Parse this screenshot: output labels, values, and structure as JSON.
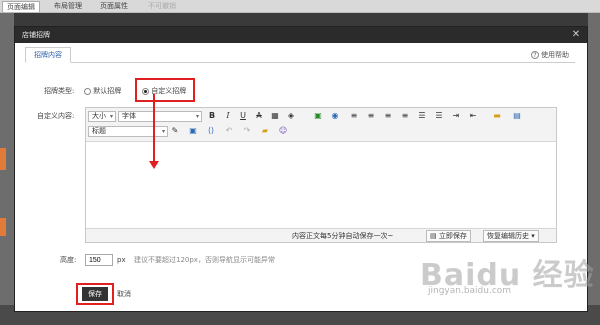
{
  "topbar": {
    "tabs": [
      {
        "label": "页面编辑",
        "active": true
      },
      {
        "label": "布局管理",
        "active": false
      },
      {
        "label": "页面属性",
        "active": false
      },
      {
        "label": "不可撤销",
        "active": false,
        "disabled": true
      }
    ]
  },
  "dialog": {
    "title": "店铺招牌",
    "close_icon": "close-icon",
    "tab_label": "招牌内容",
    "help_label": "使用帮助",
    "sign_type_label": "招牌类型:",
    "radio_default_label": "默认招牌",
    "radio_custom_label": "自定义招牌",
    "custom_content_label": "自定义内容:",
    "toolbar": {
      "size_select": "大小",
      "font_select": "字体",
      "heading_select": "标题"
    },
    "status": {
      "autosave_text": "内容正文每5分钟自动保存一次~",
      "save_now_label": "立即保存",
      "history_label": "恢复编辑历史"
    },
    "height_label": "高度:",
    "height_value": "150",
    "height_unit": "px",
    "height_hint": "建议不要超过120px，否则导航显示可能异常",
    "save_label": "保存",
    "cancel_label": "取消"
  },
  "watermark": {
    "brand": "Baidu 经验",
    "url": "jingyan.baidu.com"
  },
  "colors": {
    "highlight": "#e02020",
    "title_bar": "#2b2b2b",
    "tab_text": "#2a5cab",
    "save_button": "#333333"
  }
}
